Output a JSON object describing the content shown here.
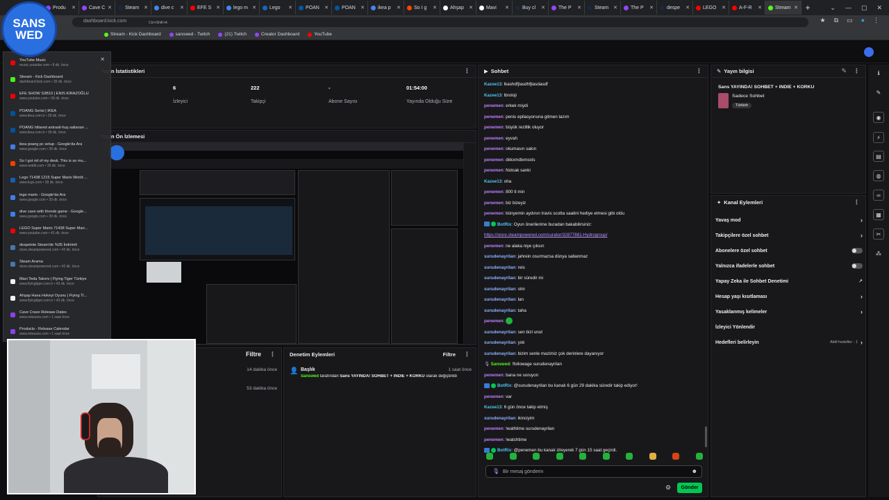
{
  "browser": {
    "tabs": [
      {
        "label": "Produ",
        "color": "#9146ff"
      },
      {
        "label": "Cave C",
        "color": "#9146ff"
      },
      {
        "label": "Steam",
        "color": "#1b2838"
      },
      {
        "label": "dive c",
        "color": "#4285f4"
      },
      {
        "label": "EFE S",
        "color": "#ff0000"
      },
      {
        "label": "lego m",
        "color": "#4285f4"
      },
      {
        "label": "Lego",
        "color": "#1565c0"
      },
      {
        "label": "POAN",
        "color": "#0058a3"
      },
      {
        "label": "POAN",
        "color": "#0058a3"
      },
      {
        "label": "ikea p",
        "color": "#4285f4"
      },
      {
        "label": "So I g",
        "color": "#ff4500"
      },
      {
        "label": "Ahşap",
        "color": "#ffffff"
      },
      {
        "label": "Mavi",
        "color": "#ffffff"
      },
      {
        "label": "Buy cl",
        "color": "#1b2838"
      },
      {
        "label": "The P",
        "color": "#9146ff"
      },
      {
        "label": "Steam",
        "color": "#1b2838"
      },
      {
        "label": "The P",
        "color": "#9146ff"
      },
      {
        "label": "despe",
        "color": "#1b2838"
      },
      {
        "label": "LEGO",
        "color": "#ff0000"
      },
      {
        "label": "A-F-R",
        "color": "#ff0000"
      },
      {
        "label": "Stream",
        "color": "#53fc18",
        "active": true
      }
    ],
    "new_tab": "+",
    "window_controls": [
      "⌄",
      "—",
      "▢",
      "✕"
    ],
    "address_hint": "Ctrl+Shift+A",
    "address_text": "dashboard.kick.com",
    "bookmarks": [
      {
        "label": "Stream - Kick Dashboard",
        "color": "#53fc18"
      },
      {
        "label": "sanswed - Twitch",
        "color": "#9146ff"
      },
      {
        "label": "(21) Twitch",
        "color": "#9146ff"
      },
      {
        "label": "Creator Dashboard",
        "color": "#9146ff"
      },
      {
        "label": "YouTube",
        "color": "#ff0000"
      }
    ]
  },
  "logo": {
    "line1": "SANS",
    "line2": "WED"
  },
  "history": [
    {
      "title": "YouTube Music",
      "sub": "music.youtube.com • 8 dk. önce",
      "color": "#ff0000"
    },
    {
      "title": "Stream - Kick Dashboard",
      "sub": "dashboard.kick.com • 39 dk. önce",
      "color": "#53fc18"
    },
    {
      "title": "EFE SHOW S3B10 | ENIS KIRAZOĞLU",
      "sub": "www.youtube.com • 39 dk. önce",
      "color": "#ff0000"
    },
    {
      "title": "POANG Serisi | IKEA",
      "sub": "www.ikea.com.tr • 39 dk. önce",
      "color": "#0058a3"
    },
    {
      "title": "POANG hillared antrasit-huş sallanan ...",
      "sub": "www.ikea.com.tr • 39 dk. önce",
      "color": "#0058a3"
    },
    {
      "title": "ikea poang pc setup - Google'da Ara",
      "sub": "www.google.com • 39 dk. önce",
      "color": "#4285f4"
    },
    {
      "title": "So I got rid of my desk. This is so mu...",
      "sub": "www.reddit.com • 39 dk. önce",
      "color": "#ff4500"
    },
    {
      "title": "Lego 71438 1215 Super Mario World ...",
      "sub": "www.lego.com • 39 dk. önce",
      "color": "#1565c0"
    },
    {
      "title": "lego mario - Google'da Ara",
      "sub": "www.google.com • 39 dk. önce",
      "color": "#4285f4"
    },
    {
      "title": "dive cave with friends game - Google...",
      "sub": "www.google.com • 39 dk. önce",
      "color": "#4285f4"
    },
    {
      "title": "LEGO Super Mario 71438 Super Mari...",
      "sub": "www.youtube.com • 41 dk. önce",
      "color": "#ff0000"
    },
    {
      "title": "despelote Steam'de %35 İndirimli",
      "sub": "store.steampowered.com • 42 dk. önce",
      "color": "#4a7fb5"
    },
    {
      "title": "Steam Arama",
      "sub": "store.steampowered.com • 42 dk. önce",
      "color": "#4a7fb5"
    },
    {
      "title": "Mavi Teda Takımı | Flying Tiger Türkiye",
      "sub": "www.flyingtiger.com.tr • 43 dk. önce",
      "color": "#ffffff"
    },
    {
      "title": "Ahşap Hava Hokeyi Oyunu | Flying Ti...",
      "sub": "www.flyingtiger.com.tr • 43 dk. önce",
      "color": "#ffffff"
    },
    {
      "title": "Cave Crave Release Dates",
      "sub": "www.releases.com • 1 saat önce",
      "color": "#9146ff"
    },
    {
      "title": "Products - Release Calendar",
      "sub": "www.releases.com • 1 saat önce",
      "color": "#9146ff"
    }
  ],
  "stats": {
    "title": "Yayın İstatistikleri",
    "items": [
      {
        "value": "6",
        "label": "İzleyici"
      },
      {
        "value": "222",
        "label": "Takipçi"
      },
      {
        "value": "-",
        "label": "Abone Sayısı"
      },
      {
        "value": "01:54:00",
        "label": "Yayında Olduğu Süre"
      }
    ]
  },
  "preview": {
    "title": "Yayın Ön İzlemesi"
  },
  "mod": {
    "filter": "Filtre",
    "times": [
      "14 dakika önce",
      "53 dakika önce"
    ]
  },
  "actions_panel": {
    "title": "Denetim Eylemleri",
    "filter": "Filtre",
    "item": {
      "title": "Başlık",
      "time": "1 saat önce",
      "user": "Sanswed",
      "pre": " tarafından ",
      "value": "Sans YAYINDA! SOHBET + INDIE + KORKU",
      "post": " olarak değiştirildi"
    }
  },
  "chat": {
    "title": "Sohbet",
    "messages": [
      {
        "user": "Kazee13",
        "color": "#53c5e8",
        "text": "lkashdfjlasdhfjlasdasdf"
      },
      {
        "user": "Kazee13",
        "color": "#53c5e8",
        "text": "lbroloji"
      },
      {
        "user": "penemen",
        "color": "#c080ff",
        "text": "erkek miydi"
      },
      {
        "user": "penemen",
        "color": "#c080ff",
        "text": "penis epilasyonuna gitmen lazım"
      },
      {
        "user": "penemen",
        "color": "#c080ff",
        "text": "büyük rezillik oluyor"
      },
      {
        "user": "penemen",
        "color": "#c080ff",
        "text": "eyvah"
      },
      {
        "user": "penemen",
        "color": "#c080ff",
        "text": "okumasın sakın"
      },
      {
        "user": "penemen",
        "color": "#c080ff",
        "text": "dkkxmdlxmsxls"
      },
      {
        "user": "penemen",
        "color": "#c080ff",
        "text": "Nolcak sanki"
      },
      {
        "user": "Kazee13",
        "color": "#53c5e8",
        "text": "oha"
      },
      {
        "user": "penemen",
        "color": "#c080ff",
        "text": "800 tl min"
      },
      {
        "user": "penemen",
        "color": "#c080ff",
        "text": "biz bizeyiz"
      },
      {
        "user": "penemen",
        "color": "#c080ff",
        "text": "bünyemin aydının travis scotta saatini hediye etmesi gibi oldu"
      },
      {
        "user": "BotRix",
        "color": "#4fc3f7",
        "bot": true,
        "text": "Oyun önerilerime buradan bakabilirsiniz:",
        "link": "https://store.steampowered.com/curator/32877881-Hydrogroup/"
      },
      {
        "user": "penemen",
        "color": "#c080ff",
        "text": "ne alaka niye çıksın"
      },
      {
        "user": "surudenayrilan",
        "color": "#8fb2ff",
        "text": "jahrein osurmazsa dünya sallanmaz"
      },
      {
        "user": "surudenayrilan",
        "color": "#8fb2ff",
        "text": "reis"
      },
      {
        "user": "surudenayrilan",
        "color": "#8fb2ff",
        "text": "bir süredir mi"
      },
      {
        "user": "surudenayrilan",
        "color": "#8fb2ff",
        "text": "olm"
      },
      {
        "user": "surudenayrilan",
        "color": "#8fb2ff",
        "text": "lan"
      },
      {
        "user": "surudenayrilan",
        "color": "#8fb2ff",
        "text": "taha"
      },
      {
        "user": "penemen",
        "color": "#c080ff",
        "text": "",
        "emote": true
      },
      {
        "user": "surudenayrilan",
        "color": "#8fb2ff",
        "text": "sen bizi unut"
      },
      {
        "user": "surudenayrilan",
        "color": "#8fb2ff",
        "text": "yok"
      },
      {
        "user": "surudenayrilan",
        "color": "#8fb2ff",
        "text": "bizim senle mazimiz çok derinlere dayanıyor"
      },
      {
        "user": "Sanswed",
        "color": "#53fc18",
        "mic": true,
        "text": "!followage surudenayrilan"
      },
      {
        "user": "penemen",
        "color": "#c080ff",
        "text": "bana ne soruyon"
      },
      {
        "user": "BotRix",
        "color": "#4fc3f7",
        "bot": true,
        "text": "@surudenayrilan bu kanalı 6 gün 29 dakika süredir takip ediyor!"
      },
      {
        "user": "penemen",
        "color": "#c080ff",
        "text": "var"
      },
      {
        "user": "Kazee13",
        "color": "#53c5e8",
        "text": "6 gün önce takip etmiş"
      },
      {
        "user": "surudenayrilan",
        "color": "#8fb2ff",
        "text": "ikinciyim"
      },
      {
        "user": "penemen",
        "color": "#c080ff",
        "text": "!wathtime surudenayrilan"
      },
      {
        "user": "penemen",
        "color": "#c080ff",
        "text": "!watchtime"
      },
      {
        "user": "BotRix",
        "color": "#4fc3f7",
        "bot": true,
        "text": "@penemen bu kanalı izleyerek 7 gün 15 saat geçirdi."
      }
    ],
    "placeholder": "Bir mesaj gönderin",
    "send": "Gönder"
  },
  "stream_info": {
    "title": "Yayın bilgisi",
    "stream_title": "Sans YAYINDA! SOHBET + INDIE + KORKU",
    "category": "Sadece Sohbet",
    "language": "Türkish"
  },
  "channel_actions": {
    "title": "Kanal Eylemleri",
    "items": [
      {
        "label": "Yavaş mod",
        "kind": "chev"
      },
      {
        "label": "Takipçilere özel sohbet",
        "kind": "chev"
      },
      {
        "label": "Abonelere özel sohbet",
        "kind": "toggle"
      },
      {
        "label": "Yalnızca ifadelerle sohbet",
        "kind": "toggle"
      },
      {
        "label": "Yapay Zeka ile Sohbet Denetimi",
        "kind": "ext"
      },
      {
        "label": "Hesap yaşı kısıtlaması",
        "kind": "chev"
      },
      {
        "label": "Yasaklanmış kelimeler",
        "kind": "chev"
      },
      {
        "label": "İzleyici Yönlendir",
        "kind": "none"
      },
      {
        "label": "Hedefleri belirleyin",
        "kind": "goal",
        "extra": "Aktif hedefler - 1"
      }
    ]
  }
}
